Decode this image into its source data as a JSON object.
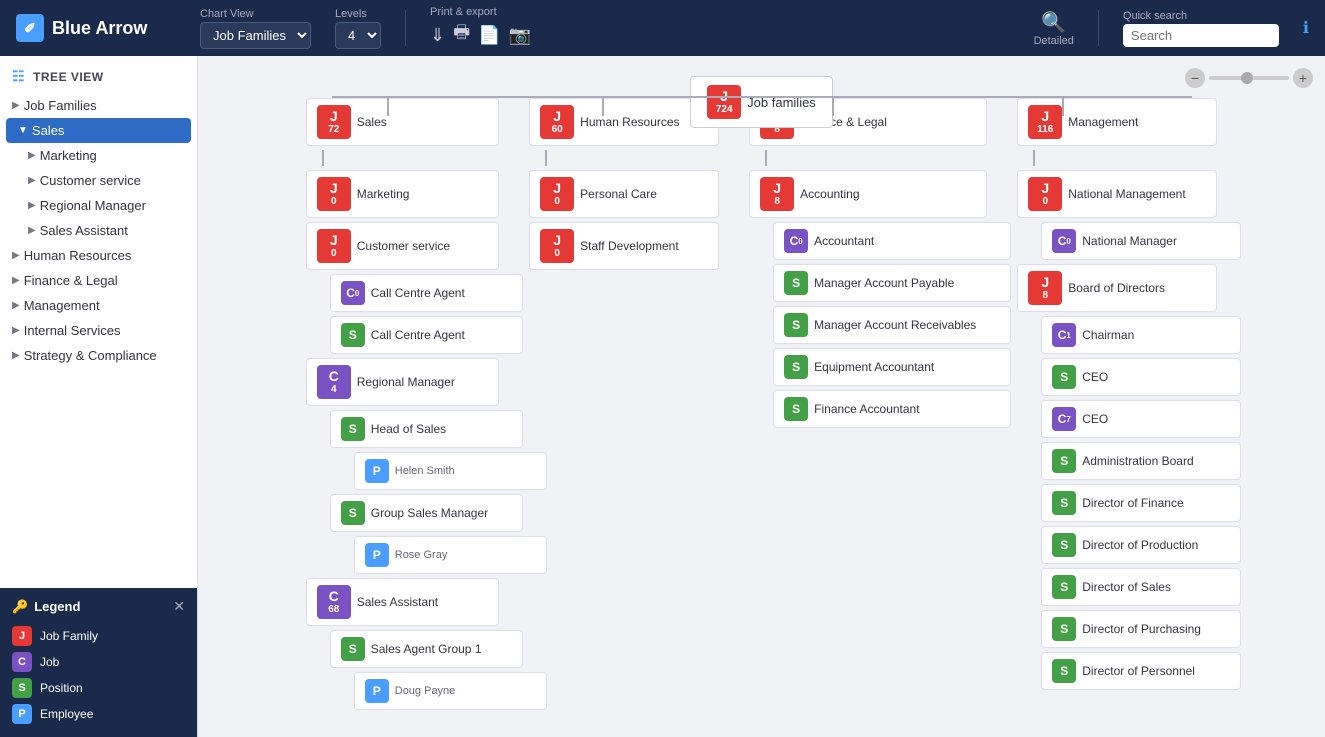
{
  "header": {
    "logo_text": "Blue Arrow",
    "chart_view_label": "Chart View",
    "chart_view_value": "Job Families",
    "levels_label": "Levels",
    "levels_value": "4",
    "print_export_label": "Print & export",
    "detailed_label": "Detailed",
    "quick_search_label": "Quick search",
    "search_placeholder": "Search",
    "info_icon": "ℹ"
  },
  "sidebar": {
    "tree_view_label": "TREE VIEW",
    "items": [
      {
        "id": "job-families",
        "label": "Job Families",
        "level": 0,
        "expanded": true
      },
      {
        "id": "sales",
        "label": "Sales",
        "level": 1,
        "active": true,
        "expanded": true
      },
      {
        "id": "marketing",
        "label": "Marketing",
        "level": 2
      },
      {
        "id": "customer-service",
        "label": "Customer service",
        "level": 2
      },
      {
        "id": "regional-manager",
        "label": "Regional Manager",
        "level": 2
      },
      {
        "id": "sales-assistant",
        "label": "Sales Assistant",
        "level": 2
      },
      {
        "id": "human-resources",
        "label": "Human Resources",
        "level": 1
      },
      {
        "id": "finance-legal",
        "label": "Finance & Legal",
        "level": 1
      },
      {
        "id": "management",
        "label": "Management",
        "level": 1
      },
      {
        "id": "internal-services",
        "label": "Internal Services",
        "level": 1
      },
      {
        "id": "strategy-compliance",
        "label": "Strategy & Compliance",
        "level": 1
      }
    ]
  },
  "legend": {
    "title": "Legend",
    "items": [
      {
        "type": "J",
        "label": "Job Family",
        "color": "badge-j"
      },
      {
        "type": "C",
        "label": "Job",
        "color": "badge-c"
      },
      {
        "type": "S",
        "label": "Position",
        "color": "badge-s"
      },
      {
        "type": "P",
        "label": "Employee",
        "color": "badge-p"
      }
    ]
  },
  "chart": {
    "root": {
      "letter": "J",
      "number": "724",
      "label": "Job families"
    },
    "columns": [
      {
        "header_letter": "J",
        "header_number": "72",
        "header_label": "Sales",
        "children": [
          {
            "letter": "J",
            "number": "0",
            "label": "Marketing",
            "color": "badge-j",
            "children": []
          },
          {
            "letter": "J",
            "number": "0",
            "label": "Customer service",
            "color": "badge-j",
            "children": [
              {
                "letter": "C",
                "number": "0",
                "label": "Call Centre Agent",
                "color": "badge-c",
                "children": []
              },
              {
                "letter": "S",
                "number": "",
                "label": "Call Centre Agent",
                "color": "badge-s",
                "children": []
              }
            ]
          },
          {
            "letter": "C",
            "number": "4",
            "label": "Regional Manager",
            "color": "badge-c",
            "children": [
              {
                "letter": "S",
                "number": "",
                "label": "Head of Sales",
                "color": "badge-s",
                "children": [
                  {
                    "letter": "P",
                    "label": "Helen Smith",
                    "color": "badge-p"
                  }
                ]
              },
              {
                "letter": "S",
                "number": "",
                "label": "Group Sales Manager",
                "color": "badge-s",
                "children": [
                  {
                    "letter": "P",
                    "label": "Rose Gray",
                    "color": "badge-p"
                  }
                ]
              }
            ]
          },
          {
            "letter": "C",
            "number": "68",
            "label": "Sales Assistant",
            "color": "badge-c",
            "children": [
              {
                "letter": "S",
                "number": "",
                "label": "Sales Agent Group 1",
                "color": "badge-s",
                "children": [
                  {
                    "letter": "P",
                    "label": "Doug Payne",
                    "color": "badge-p"
                  }
                ]
              }
            ]
          }
        ]
      },
      {
        "header_letter": "J",
        "header_number": "60",
        "header_label": "Human Resources",
        "children": [
          {
            "letter": "J",
            "number": "0",
            "label": "Personal Care",
            "color": "badge-j",
            "children": []
          },
          {
            "letter": "J",
            "number": "0",
            "label": "Staff Development",
            "color": "badge-j",
            "children": []
          }
        ]
      },
      {
        "header_letter": "J",
        "header_number": "8",
        "header_label": "Finance & Legal",
        "children": [
          {
            "letter": "J",
            "number": "8",
            "label": "Accounting",
            "color": "badge-j",
            "children": [
              {
                "letter": "C",
                "number": "0",
                "label": "Accountant",
                "color": "badge-c",
                "children": []
              },
              {
                "letter": "S",
                "number": "",
                "label": "Manager Account Payable",
                "color": "badge-s",
                "children": []
              },
              {
                "letter": "S",
                "number": "",
                "label": "Manager Account Receivables",
                "color": "badge-s",
                "children": []
              },
              {
                "letter": "S",
                "number": "",
                "label": "Equipment Accountant",
                "color": "badge-s",
                "children": []
              },
              {
                "letter": "S",
                "number": "",
                "label": "Finance Accountant",
                "color": "badge-s",
                "children": []
              }
            ]
          }
        ]
      },
      {
        "header_letter": "J",
        "header_number": "116",
        "header_label": "Management",
        "children": [
          {
            "letter": "J",
            "number": "0",
            "label": "National Management",
            "color": "badge-j",
            "children": [
              {
                "letter": "C",
                "number": "0",
                "label": "National Manager",
                "color": "badge-c",
                "children": []
              }
            ]
          },
          {
            "letter": "J",
            "number": "8",
            "label": "Board of Directors",
            "color": "badge-j",
            "children": [
              {
                "letter": "C",
                "number": "1",
                "label": "Chairman",
                "color": "badge-c",
                "children": []
              },
              {
                "letter": "S",
                "number": "",
                "label": "CEO",
                "color": "badge-s",
                "children": []
              },
              {
                "letter": "C",
                "number": "7",
                "label": "CEO",
                "color": "badge-c",
                "children": []
              },
              {
                "letter": "S",
                "number": "",
                "label": "Administration Board",
                "color": "badge-s",
                "children": []
              },
              {
                "letter": "S",
                "number": "",
                "label": "Director of Finance",
                "color": "badge-s",
                "children": []
              },
              {
                "letter": "S",
                "number": "",
                "label": "Director of Production",
                "color": "badge-s",
                "children": []
              },
              {
                "letter": "S",
                "number": "",
                "label": "Director of Sales",
                "color": "badge-s",
                "children": []
              },
              {
                "letter": "S",
                "number": "",
                "label": "Director of Purchasing",
                "color": "badge-s",
                "children": []
              },
              {
                "letter": "S",
                "number": "",
                "label": "Director of Personnel",
                "color": "badge-s",
                "children": []
              }
            ]
          }
        ]
      }
    ]
  },
  "zoom": {
    "minus": "−",
    "plus": "+"
  }
}
